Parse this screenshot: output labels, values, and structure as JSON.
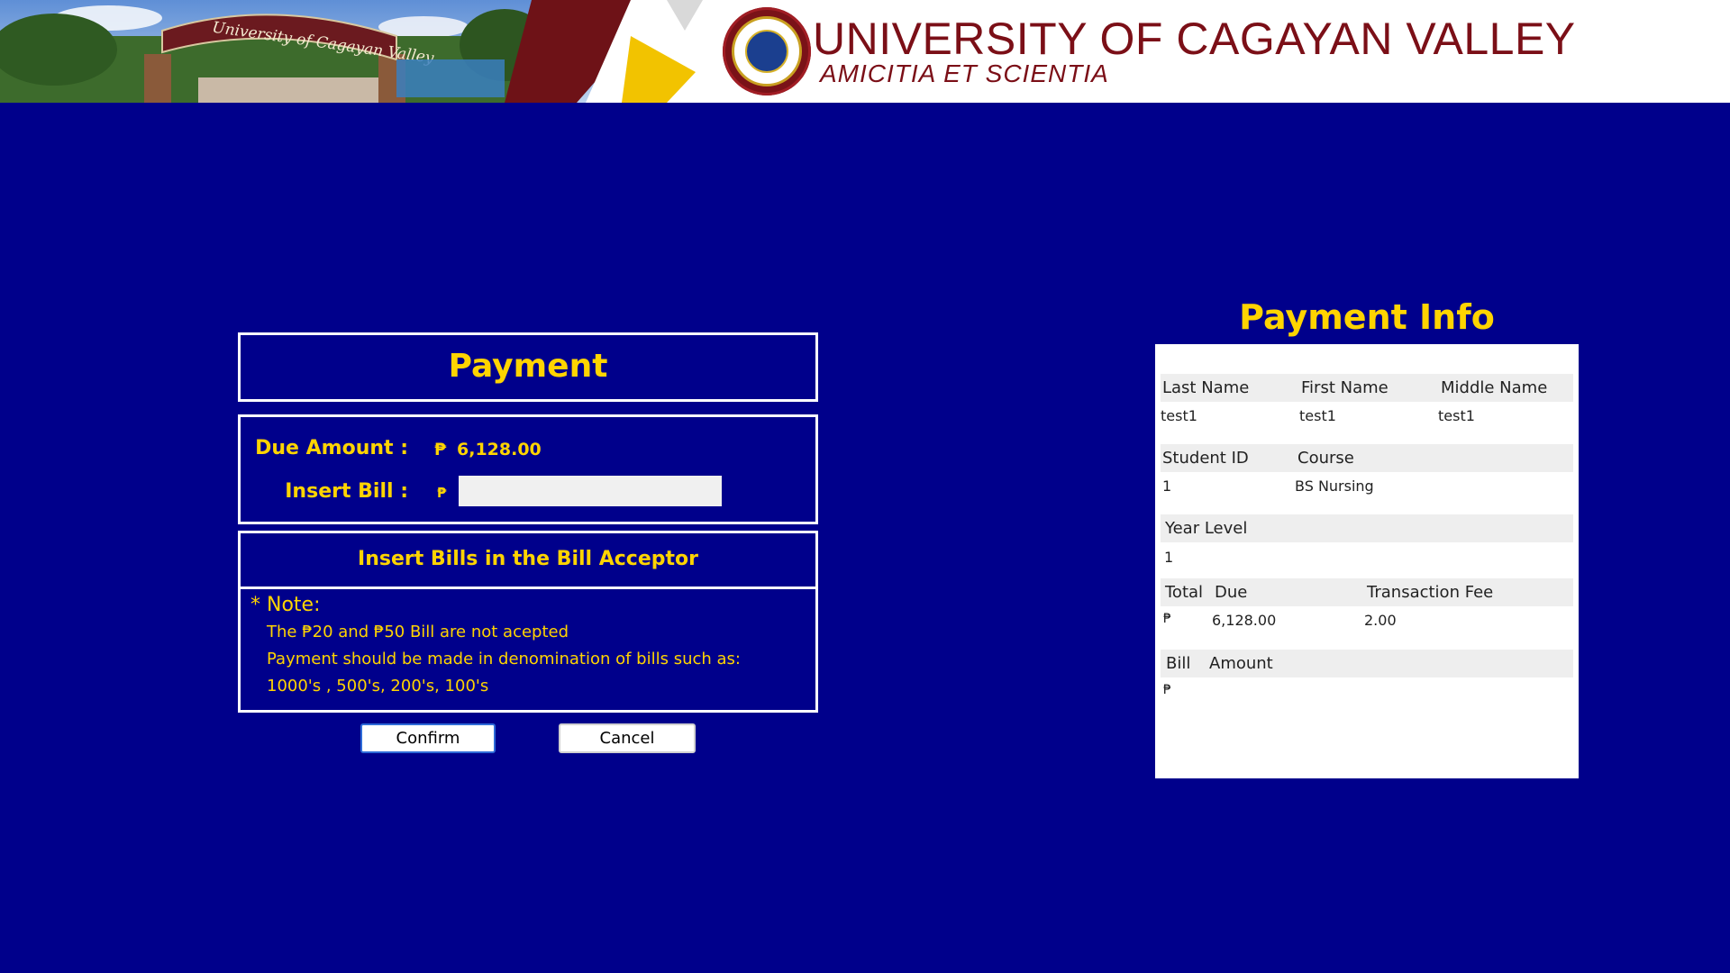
{
  "header": {
    "university_name": "UNIVERSITY OF CAGAYAN VALLEY",
    "motto": "AMICITIA ET SCIENTIA",
    "gate_sign": "University of Cagayan Valley",
    "seal_text": "UNIVERSITY OF CAGAYAN VALLEY 1948",
    "brand_color": "#7b0f17"
  },
  "payment": {
    "title": "Payment",
    "due_label": "Due Amount :",
    "currency": "₱",
    "due_value": "6,128.00",
    "insert_label": "Insert Bill :",
    "insert_value": "",
    "acceptor_title": "Insert Bills in the Bill Acceptor",
    "note_head": "* Note:",
    "note_lines": [
      "The ₱20 and ₱50 Bill are not acepted",
      "Payment should be made in denomination of bills such as:",
      "1000's , 500's, 200's, 100's"
    ],
    "confirm_label": "Confirm",
    "cancel_label": "Cancel"
  },
  "info": {
    "title": "Payment Info",
    "last_name_label": "Last Name",
    "first_name_label": "First Name",
    "middle_name_label": "Middle Name",
    "last_name": "test1",
    "first_name": "test1",
    "middle_name": "test1",
    "student_id_label": "Student ID",
    "course_label": "Course",
    "student_id": "1",
    "course": "BS Nursing",
    "year_level_label": "Year Level",
    "year_level": "1",
    "total_label": "Total",
    "due_label": "Due",
    "fee_label": "Transaction Fee",
    "currency": "₱",
    "total_due": "6,128.00",
    "fee": "2.00",
    "bill_label": "Bill",
    "amount_label": "Amount",
    "bill_amount": ""
  },
  "colors": {
    "background": "#00008b",
    "accent_text": "#ffd400",
    "border": "#ffffff"
  }
}
